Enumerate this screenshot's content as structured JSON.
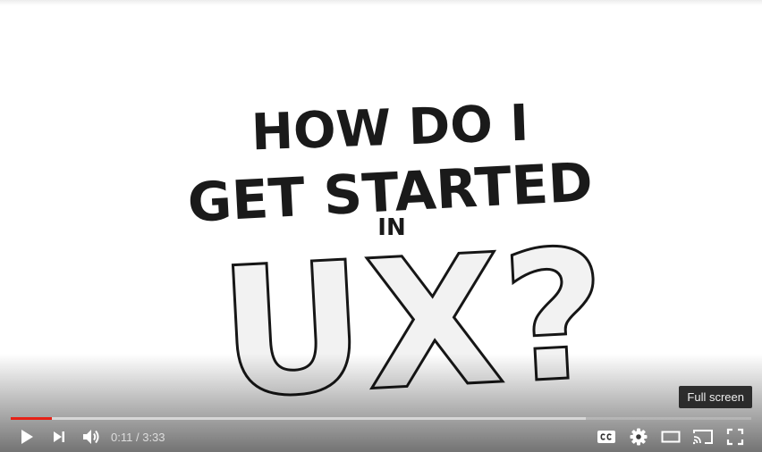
{
  "video": {
    "title_lines": [
      "HOW DO I",
      "GET STARTED",
      "IN"
    ],
    "big_text": "UX?"
  },
  "tooltip": {
    "text": "Full screen"
  },
  "player": {
    "current_time": "0:11",
    "duration": "3:33",
    "separator": "/",
    "progress_played_fraction": 0.055,
    "progress_loaded_fraction": 0.776
  },
  "icons": {
    "play": "play-icon",
    "next": "next-icon",
    "volume": "volume-icon",
    "captions": "cc-icon",
    "settings": "gear-icon",
    "theater": "theater-mode-icon",
    "cast": "cast-icon",
    "fullscreen": "fullscreen-icon"
  },
  "colors": {
    "progress_played": "#e62117",
    "icon": "#ffffff"
  }
}
